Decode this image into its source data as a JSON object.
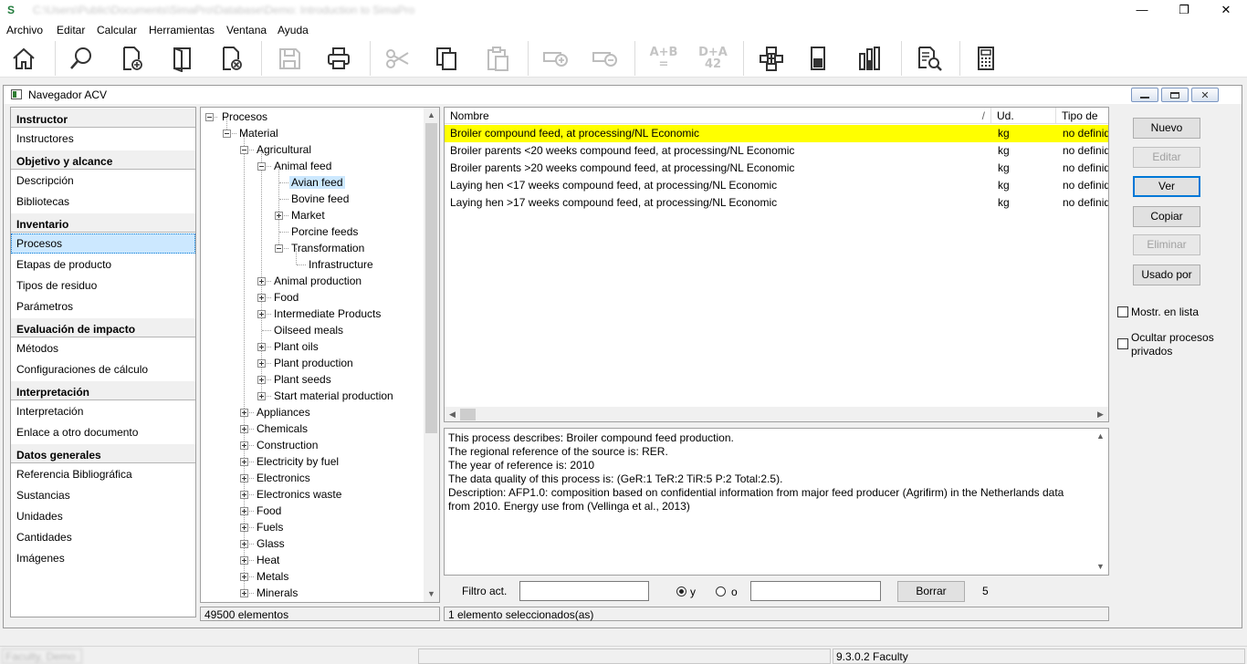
{
  "window": {
    "title": "C:\\Users\\Public\\Documents\\SimaPro\\Database\\Demo: Introduction to SimaPro",
    "logo": "S",
    "minimize": "—",
    "restore": "❐",
    "close": "✕"
  },
  "menu": [
    "Archivo",
    "Editar",
    "Calcular",
    "Herramientas",
    "Ventana",
    "Ayuda"
  ],
  "toolbar": {
    "icons": [
      "home-icon",
      "search-icon",
      "new-document-icon",
      "open-library-icon",
      "delete-document-icon",
      "save-icon",
      "print-icon",
      "cut-icon",
      "copy-icon",
      "paste-icon",
      "add-item-icon",
      "remove-item-icon",
      "sum-icon",
      "sum-total-icon",
      "network-icon",
      "tree-chart-icon",
      "bar-chart-icon",
      "compare-documents-icon",
      "calculator-icon"
    ],
    "sum_label_top": "A+B",
    "sum_label_bottom": "=",
    "total_label_top": "D+A",
    "total_label_bottom": "42"
  },
  "navigator": {
    "title": "Navegador ACV",
    "sections": [
      {
        "header": "Instructor",
        "items": [
          "Instructores"
        ]
      },
      {
        "header": "Objetivo y alcance",
        "items": [
          "Descripción",
          "Bibliotecas"
        ]
      },
      {
        "header": "Inventario",
        "items": [
          "Procesos",
          "Etapas de producto",
          "Tipos de residuo",
          "Parámetros"
        ]
      },
      {
        "header": "Evaluación de impacto",
        "items": [
          "Métodos",
          "Configuraciones de cálculo"
        ]
      },
      {
        "header": "Interpretación",
        "items": [
          "Interpretación",
          "Enlace a otro documento"
        ]
      },
      {
        "header": "Datos generales",
        "items": [
          "Referencia Bibliográfica",
          "Sustancias",
          "Unidades",
          "Cantidades",
          "Imágenes"
        ]
      }
    ],
    "selected": "Procesos"
  },
  "tree": {
    "rows": [
      {
        "label": "Procesos",
        "level": 0,
        "exp": "minus"
      },
      {
        "label": "Material",
        "level": 1,
        "exp": "minus"
      },
      {
        "label": "Agricultural",
        "level": 2,
        "exp": "minus"
      },
      {
        "label": "Animal feed",
        "level": 3,
        "exp": "minus"
      },
      {
        "label": "Avian feed",
        "level": 4,
        "exp": "",
        "selected": true
      },
      {
        "label": "Bovine feed",
        "level": 4,
        "exp": ""
      },
      {
        "label": "Market",
        "level": 4,
        "exp": "plus"
      },
      {
        "label": "Porcine feeds",
        "level": 4,
        "exp": ""
      },
      {
        "label": "Transformation",
        "level": 4,
        "exp": "minus"
      },
      {
        "label": "Infrastructure",
        "level": 5,
        "exp": ""
      },
      {
        "label": "Animal production",
        "level": 3,
        "exp": "plus"
      },
      {
        "label": "Food",
        "level": 3,
        "exp": "plus"
      },
      {
        "label": "Intermediate Products",
        "level": 3,
        "exp": "plus"
      },
      {
        "label": "Oilseed meals",
        "level": 3,
        "exp": ""
      },
      {
        "label": "Plant oils",
        "level": 3,
        "exp": "plus"
      },
      {
        "label": "Plant production",
        "level": 3,
        "exp": "plus"
      },
      {
        "label": "Plant seeds",
        "level": 3,
        "exp": "plus"
      },
      {
        "label": "Start material production",
        "level": 3,
        "exp": "plus"
      },
      {
        "label": "Appliances",
        "level": 2,
        "exp": "plus"
      },
      {
        "label": "Chemicals",
        "level": 2,
        "exp": "plus"
      },
      {
        "label": "Construction",
        "level": 2,
        "exp": "plus"
      },
      {
        "label": "Electricity by fuel",
        "level": 2,
        "exp": "plus"
      },
      {
        "label": "Electronics",
        "level": 2,
        "exp": "plus"
      },
      {
        "label": "Electronics waste",
        "level": 2,
        "exp": "plus"
      },
      {
        "label": "Food",
        "level": 2,
        "exp": "plus"
      },
      {
        "label": "Fuels",
        "level": 2,
        "exp": "plus"
      },
      {
        "label": "Glass",
        "level": 2,
        "exp": "plus"
      },
      {
        "label": "Heat",
        "level": 2,
        "exp": "plus"
      },
      {
        "label": "Metals",
        "level": 2,
        "exp": "plus"
      },
      {
        "label": "Minerals",
        "level": 2,
        "exp": "plus"
      }
    ],
    "status": "49500 elementos",
    "scroll_up": "▲",
    "scroll_down": "▼"
  },
  "list": {
    "columns": [
      "Nombre",
      "Ud.",
      "Tipo de re"
    ],
    "sort_marker": "/",
    "rows": [
      {
        "name": "Broiler compound feed, at processing/NL Economic",
        "unit": "kg",
        "type": "no definido",
        "selected": true
      },
      {
        "name": "Broiler parents <20 weeks compound feed, at processing/NL Economic",
        "unit": "kg",
        "type": "no definido"
      },
      {
        "name": "Broiler parents >20 weeks compound feed, at processing/NL Economic",
        "unit": "kg",
        "type": "no definido"
      },
      {
        "name": "Laying hen <17 weeks compound feed, at processing/NL Economic",
        "unit": "kg",
        "type": "no definido"
      },
      {
        "name": "Laying hen >17 weeks compound feed, at processing/NL Economic",
        "unit": "kg",
        "type": "no definido"
      }
    ],
    "status": "1 elemento seleccionados(as)",
    "scroll_left": "◀",
    "scroll_right": "▶"
  },
  "description": {
    "lines": [
      "This process describes: Broiler compound feed production.",
      "The regional reference of the source is: RER.",
      "The year of reference is: 2010",
      "The data quality of this process is: (GeR:1 TeR:2 TiR:5 P:2 Total:2.5).",
      "Description: AFP1.0: composition based on confidential information from major feed producer (Agrifirm) in the Netherlands data from 2010. Energy use from (Vellinga et al., 2013)"
    ]
  },
  "filter": {
    "label": "Filtro act.",
    "value1": "",
    "and_label": "y",
    "or_label": "o",
    "value2": "",
    "clear_button": "Borrar",
    "count": "5"
  },
  "buttons": {
    "new": "Nuevo",
    "edit": "Editar",
    "view": "Ver",
    "copy": "Copiar",
    "delete": "Eliminar",
    "used_by": "Usado por"
  },
  "options": {
    "show_in_list": "Mostr. en lista",
    "hide_private": "Ocultar procesos privados"
  },
  "statusbar": {
    "left": "Faculty, Demo",
    "version": "9.3.0.2 Faculty"
  },
  "colors": {
    "selection": "#ffff00",
    "tree_selection": "#cce8ff",
    "accent": "#0078d7"
  }
}
